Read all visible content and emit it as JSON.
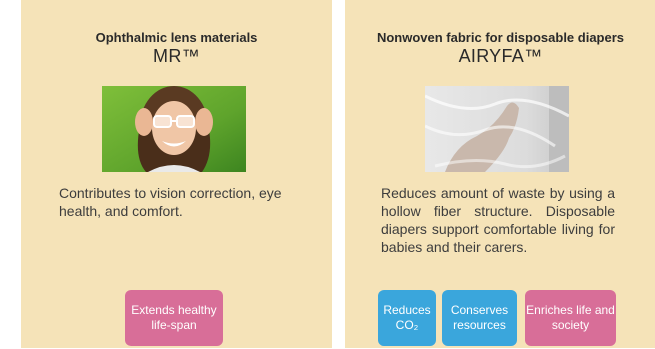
{
  "cards": [
    {
      "subtitle": "Ophthalmic lens materials",
      "title": "MR™",
      "image_icon": "woman-with-glasses-photo",
      "description": "Contributes to vision correction, eye health, and comfort.",
      "badges": [
        {
          "label": "Extends healthy life-span",
          "color": "#d86e98"
        }
      ]
    },
    {
      "subtitle": "Nonwoven fabric for disposable diapers",
      "title": "AIRYFA™",
      "image_icon": "hand-under-fabric-photo",
      "description": "Reduces amount of waste by using a hollow fiber structure. Disposable diapers support comfortable living for babies and their carers.",
      "badges": [
        {
          "label": "Reduces CO₂",
          "color": "#3aa6dc"
        },
        {
          "label": "Conserves resources",
          "color": "#3aa6dc"
        },
        {
          "label": "Enriches life and society",
          "color": "#d86e98"
        }
      ]
    }
  ],
  "colors": {
    "card_background": "#f5e3b8",
    "page_background": "#ffffff"
  }
}
